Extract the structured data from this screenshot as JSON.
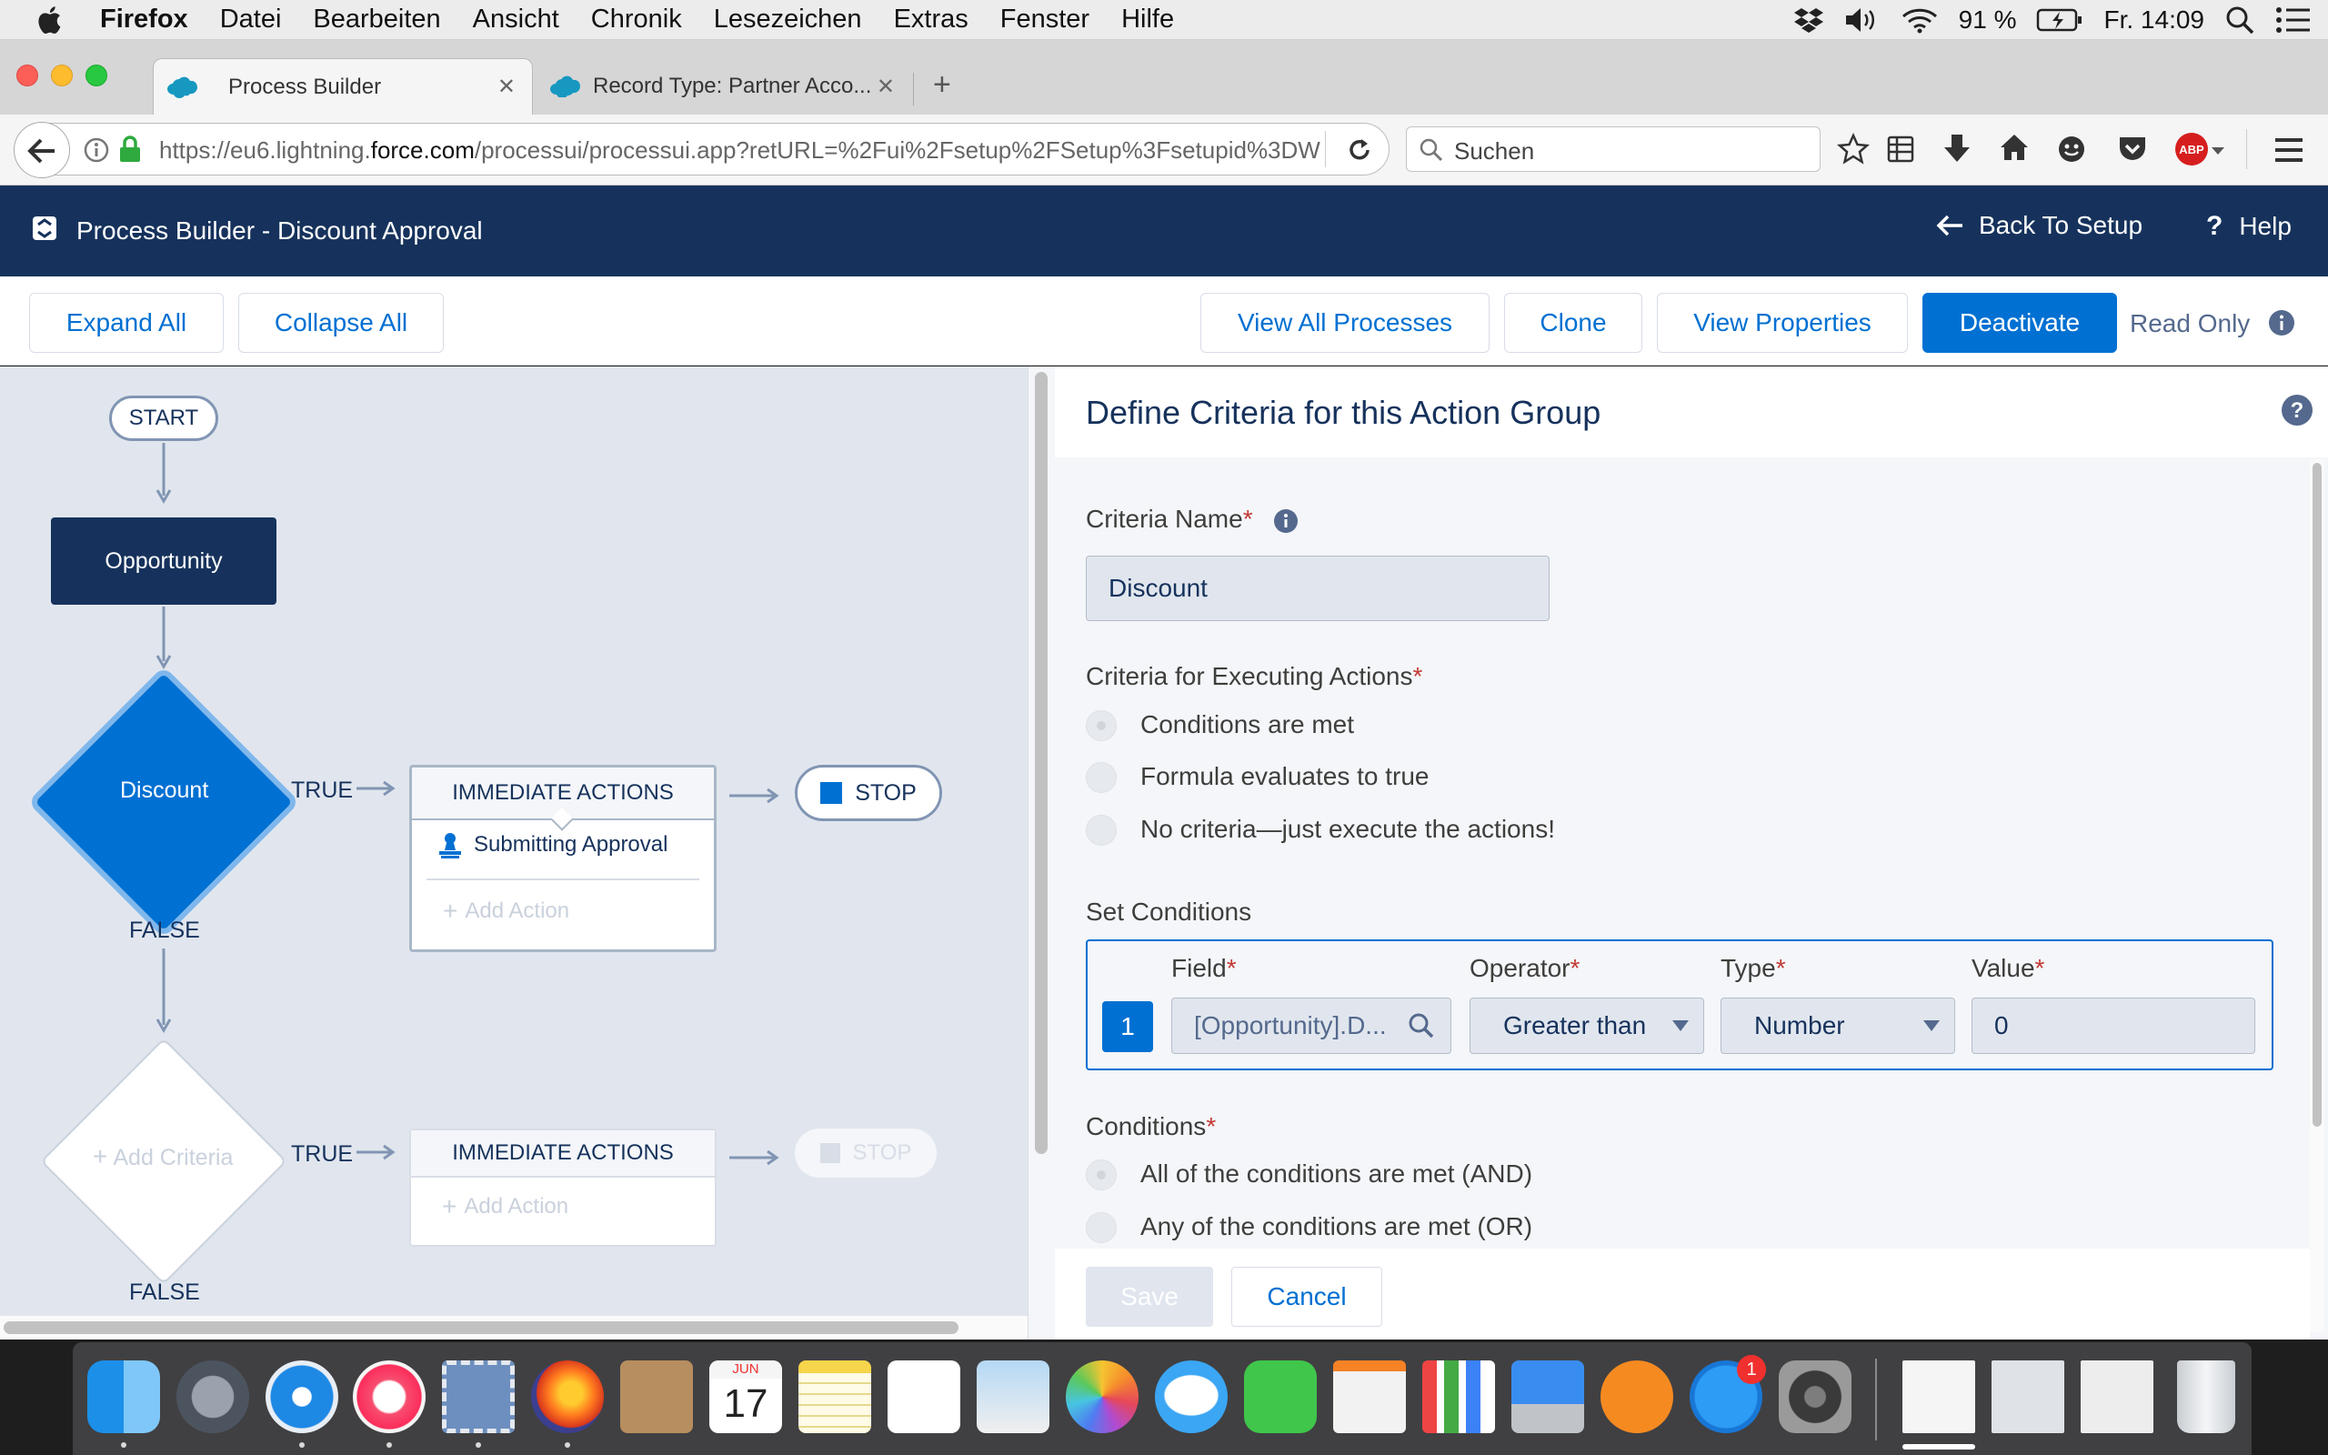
{
  "menubar": {
    "app": "Firefox",
    "items": [
      "Datei",
      "Bearbeiten",
      "Ansicht",
      "Chronik",
      "Lesezeichen",
      "Extras",
      "Fenster",
      "Hilfe"
    ],
    "battery": "91 %",
    "clock": "Fr. 14:09"
  },
  "browser": {
    "tabs": [
      {
        "label": "Process Builder"
      },
      {
        "label": "Record Type: Partner Acco..."
      }
    ],
    "url_prefix": "https://eu6.lightning.",
    "url_domain": "force.com",
    "url_path": "/processui/processui.app?retURL=%2Fui%2Fsetup%2FSetup%3Fsetupid%3DW",
    "search_placeholder": "Suchen",
    "abp_label": "ABP"
  },
  "header": {
    "title": "Process Builder - Discount Approval",
    "back_label": "Back To Setup",
    "help_label": "Help"
  },
  "toolbar": {
    "expand_all": "Expand All",
    "collapse_all": "Collapse All",
    "view_all_processes": "View All Processes",
    "clone": "Clone",
    "view_properties": "View Properties",
    "deactivate": "Deactivate",
    "read_only": "Read Only"
  },
  "canvas": {
    "start": "START",
    "object_node": "Opportunity",
    "criteria_1": "Discount",
    "true_label": "TRUE",
    "false_label": "FALSE",
    "immediate_actions": "IMMEDIATE ACTIONS",
    "action_1": "Submitting Approval",
    "add_action": "Add Action",
    "stop": "STOP",
    "add_criteria": "Add Criteria"
  },
  "panel": {
    "title": "Define Criteria for this Action Group",
    "criteria_name_label": "Criteria Name",
    "criteria_name_value": "Discount",
    "executing_label": "Criteria for Executing Actions",
    "executing_options": [
      "Conditions are met",
      "Formula evaluates to true",
      "No criteria—just execute the actions!"
    ],
    "set_conditions_label": "Set Conditions",
    "columns": {
      "field": "Field",
      "operator": "Operator",
      "type": "Type",
      "value": "Value"
    },
    "row": {
      "index": "1",
      "field": "[Opportunity].D...",
      "operator": "Greater than",
      "type": "Number",
      "value": "0"
    },
    "conditions_label": "Conditions",
    "conditions_options": [
      "All of the conditions are met (AND)",
      "Any of the conditions are met (OR)"
    ],
    "save": "Save",
    "cancel": "Cancel",
    "required_mark": "*"
  },
  "dock": {
    "calendar_month": "JUN",
    "calendar_day": "17",
    "appstore_badge": "1"
  }
}
